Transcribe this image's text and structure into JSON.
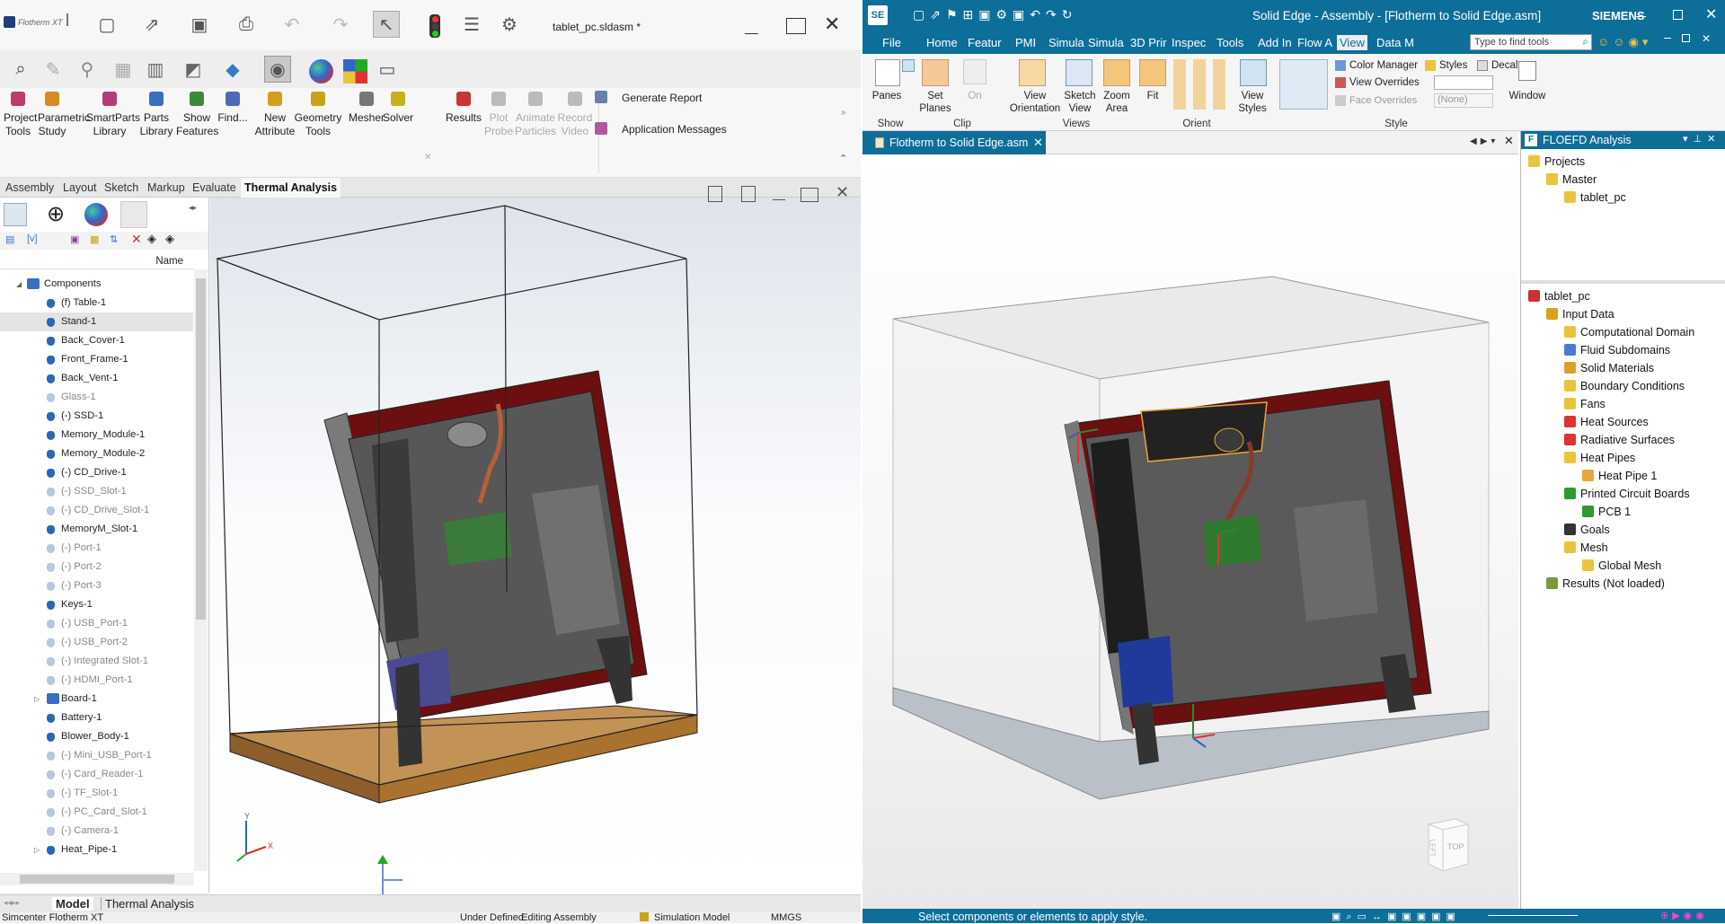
{
  "left_app": {
    "logo_text": "Flotherm XT",
    "doc_title": "tablet_pc.sldasm *",
    "ribbon": [
      {
        "label": "Project\nTools",
        "name": "project-tools-button",
        "color": "#c03a6b"
      },
      {
        "label": "Parametric\nStudy",
        "name": "parametric-study-button",
        "color": "#d98a1e"
      },
      {
        "label": "SmartParts\nLibrary",
        "name": "smartparts-library-button",
        "color": "#b73a7a"
      },
      {
        "label": "Parts\nLibrary",
        "name": "parts-library-button",
        "color": "#3a6fc0"
      },
      {
        "label": "Show\nFeatures",
        "name": "show-features-button",
        "color": "#3b8a3b"
      },
      {
        "label": "Find...",
        "name": "find-button",
        "color": "#4b6bb5"
      },
      {
        "label": "New\nAttribute",
        "name": "new-attribute-button",
        "color": "#d1a11c"
      },
      {
        "label": "Geometry\nTools",
        "name": "geometry-tools-button",
        "color": "#c9a315"
      },
      {
        "label": "Mesher",
        "name": "mesher-button",
        "color": "#777"
      },
      {
        "label": "Solver",
        "name": "solver-button",
        "color": "#c6b01c"
      },
      {
        "label": "Results",
        "name": "results-button",
        "color": "#c33"
      },
      {
        "label": "Plot\nProbe",
        "name": "plot-probe-button",
        "color": "#bbb"
      },
      {
        "label": "Animate\nParticles",
        "name": "animate-particles-button",
        "color": "#bbb"
      },
      {
        "label": "Record\nVideo",
        "name": "record-video-button",
        "color": "#bbb"
      }
    ],
    "generate_report": "Generate Report",
    "application_messages": "Application Messages",
    "tabs": [
      "Assembly",
      "Layout",
      "Sketch",
      "Markup",
      "Evaluate",
      "Thermal Analysis"
    ],
    "tree_header": "Name",
    "tree": [
      {
        "label": "Components",
        "dim": false
      },
      {
        "label": "(f) Table-1",
        "dim": false
      },
      {
        "label": "Stand-1",
        "dim": false,
        "sel": true
      },
      {
        "label": "Back_Cover-1",
        "dim": false
      },
      {
        "label": "Front_Frame-1",
        "dim": false
      },
      {
        "label": "Back_Vent-1",
        "dim": false
      },
      {
        "label": "Glass-1",
        "dim": true
      },
      {
        "label": "(-) SSD-1",
        "dim": false
      },
      {
        "label": "Memory_Module-1",
        "dim": false
      },
      {
        "label": "Memory_Module-2",
        "dim": false
      },
      {
        "label": "(-) CD_Drive-1",
        "dim": false
      },
      {
        "label": "(-) SSD_Slot-1",
        "dim": true
      },
      {
        "label": "(-) CD_Drive_Slot-1",
        "dim": true
      },
      {
        "label": "MemoryM_Slot-1",
        "dim": false
      },
      {
        "label": "(-) Port-1",
        "dim": true
      },
      {
        "label": "(-) Port-2",
        "dim": true
      },
      {
        "label": "(-) Port-3",
        "dim": true
      },
      {
        "label": "Keys-1",
        "dim": false
      },
      {
        "label": "(-) USB_Port-1",
        "dim": true
      },
      {
        "label": "(-) USB_Port-2",
        "dim": true
      },
      {
        "label": "(-) Integrated Slot-1",
        "dim": true
      },
      {
        "label": "(-) HDMI_Port-1",
        "dim": true
      },
      {
        "label": "Board-1",
        "dim": false
      },
      {
        "label": "Battery-1",
        "dim": false
      },
      {
        "label": "Blower_Body-1",
        "dim": false
      },
      {
        "label": "(-) Mini_USB_Port-1",
        "dim": true
      },
      {
        "label": "(-) Card_Reader-1",
        "dim": true
      },
      {
        "label": "(-) TF_Slot-1",
        "dim": true
      },
      {
        "label": "(-) PC_Card_Slot-1",
        "dim": true
      },
      {
        "label": "(-) Camera-1",
        "dim": true
      },
      {
        "label": "Heat_Pipe-1",
        "dim": false
      }
    ],
    "bottom_tabs": [
      "Model",
      "Thermal Analysis"
    ],
    "status": {
      "app": "Simcenter Flotherm XT",
      "state": "Under Defined",
      "mode": "Editing Assembly",
      "sim": "Simulation Model",
      "units": "MMGS"
    }
  },
  "right_app": {
    "logo": "SE",
    "title": "Solid Edge - Assembly - [Flotherm to Solid Edge.asm]",
    "brand": "SIEMENS",
    "menu": [
      "File",
      "Home",
      "Featur",
      "PMI",
      "Simula",
      "Simula",
      "3D Prir",
      "Inspec",
      "Tools",
      "Add In",
      "Flow A",
      "View",
      "Data M"
    ],
    "search_placeholder": "Type to find tools",
    "ribbon": {
      "panes": "Panes",
      "set_planes": "Set\nPlanes",
      "on": "On",
      "view_orientation": "View\nOrientation",
      "sketch_view": "Sketch\nView",
      "zoom_area": "Zoom\nArea",
      "fit": "Fit",
      "view_styles": "View\nStyles",
      "color_manager": "Color Manager",
      "styles": "Styles",
      "decal": "Decal",
      "view_overrides": "View Overrides",
      "face_overrides": "Face Overrides",
      "face_overrides_value": "(None)",
      "window": "Window",
      "groups": [
        "Show",
        "Clip",
        "Views",
        "Orient",
        "Style"
      ]
    },
    "doc_tab": "Flotherm to Solid Edge.asm",
    "pane_title": "FLOEFD Analysis",
    "projects": [
      {
        "label": "Projects",
        "indent": 0
      },
      {
        "label": "Master",
        "indent": 1
      },
      {
        "label": "tablet_pc",
        "indent": 2
      }
    ],
    "analysis_tree": [
      {
        "label": "tablet_pc",
        "indent": 0,
        "color": "#c33"
      },
      {
        "label": "Input Data",
        "indent": 1,
        "color": "#d7a21b"
      },
      {
        "label": "Computational Domain",
        "indent": 2,
        "color": "#e8c53a"
      },
      {
        "label": "Fluid Subdomains",
        "indent": 2,
        "color": "#4a7bd1"
      },
      {
        "label": "Solid Materials",
        "indent": 2,
        "color": "#d9a12a"
      },
      {
        "label": "Boundary Conditions",
        "indent": 2,
        "color": "#e8c53a"
      },
      {
        "label": "Fans",
        "indent": 2,
        "color": "#e8c53a"
      },
      {
        "label": "Heat Sources",
        "indent": 2,
        "color": "#d33"
      },
      {
        "label": "Radiative Surfaces",
        "indent": 2,
        "color": "#d33"
      },
      {
        "label": "Heat Pipes",
        "indent": 2,
        "color": "#e8c53a"
      },
      {
        "label": "Heat Pipe 1",
        "indent": 3,
        "color": "#e8a63a"
      },
      {
        "label": "Printed Circuit Boards",
        "indent": 2,
        "color": "#2f9a2f"
      },
      {
        "label": "PCB 1",
        "indent": 3,
        "color": "#2f9a2f"
      },
      {
        "label": "Goals",
        "indent": 2,
        "color": "#333"
      },
      {
        "label": "Mesh",
        "indent": 2,
        "color": "#e8c53a"
      },
      {
        "label": "Global Mesh",
        "indent": 3,
        "color": "#e8c53a"
      },
      {
        "label": "Results (Not loaded)",
        "indent": 1,
        "color": "#7a9a3a"
      }
    ],
    "view_cube_top": "TOP",
    "view_cube_left": "LEFT",
    "status": "Select components or elements to apply style."
  }
}
